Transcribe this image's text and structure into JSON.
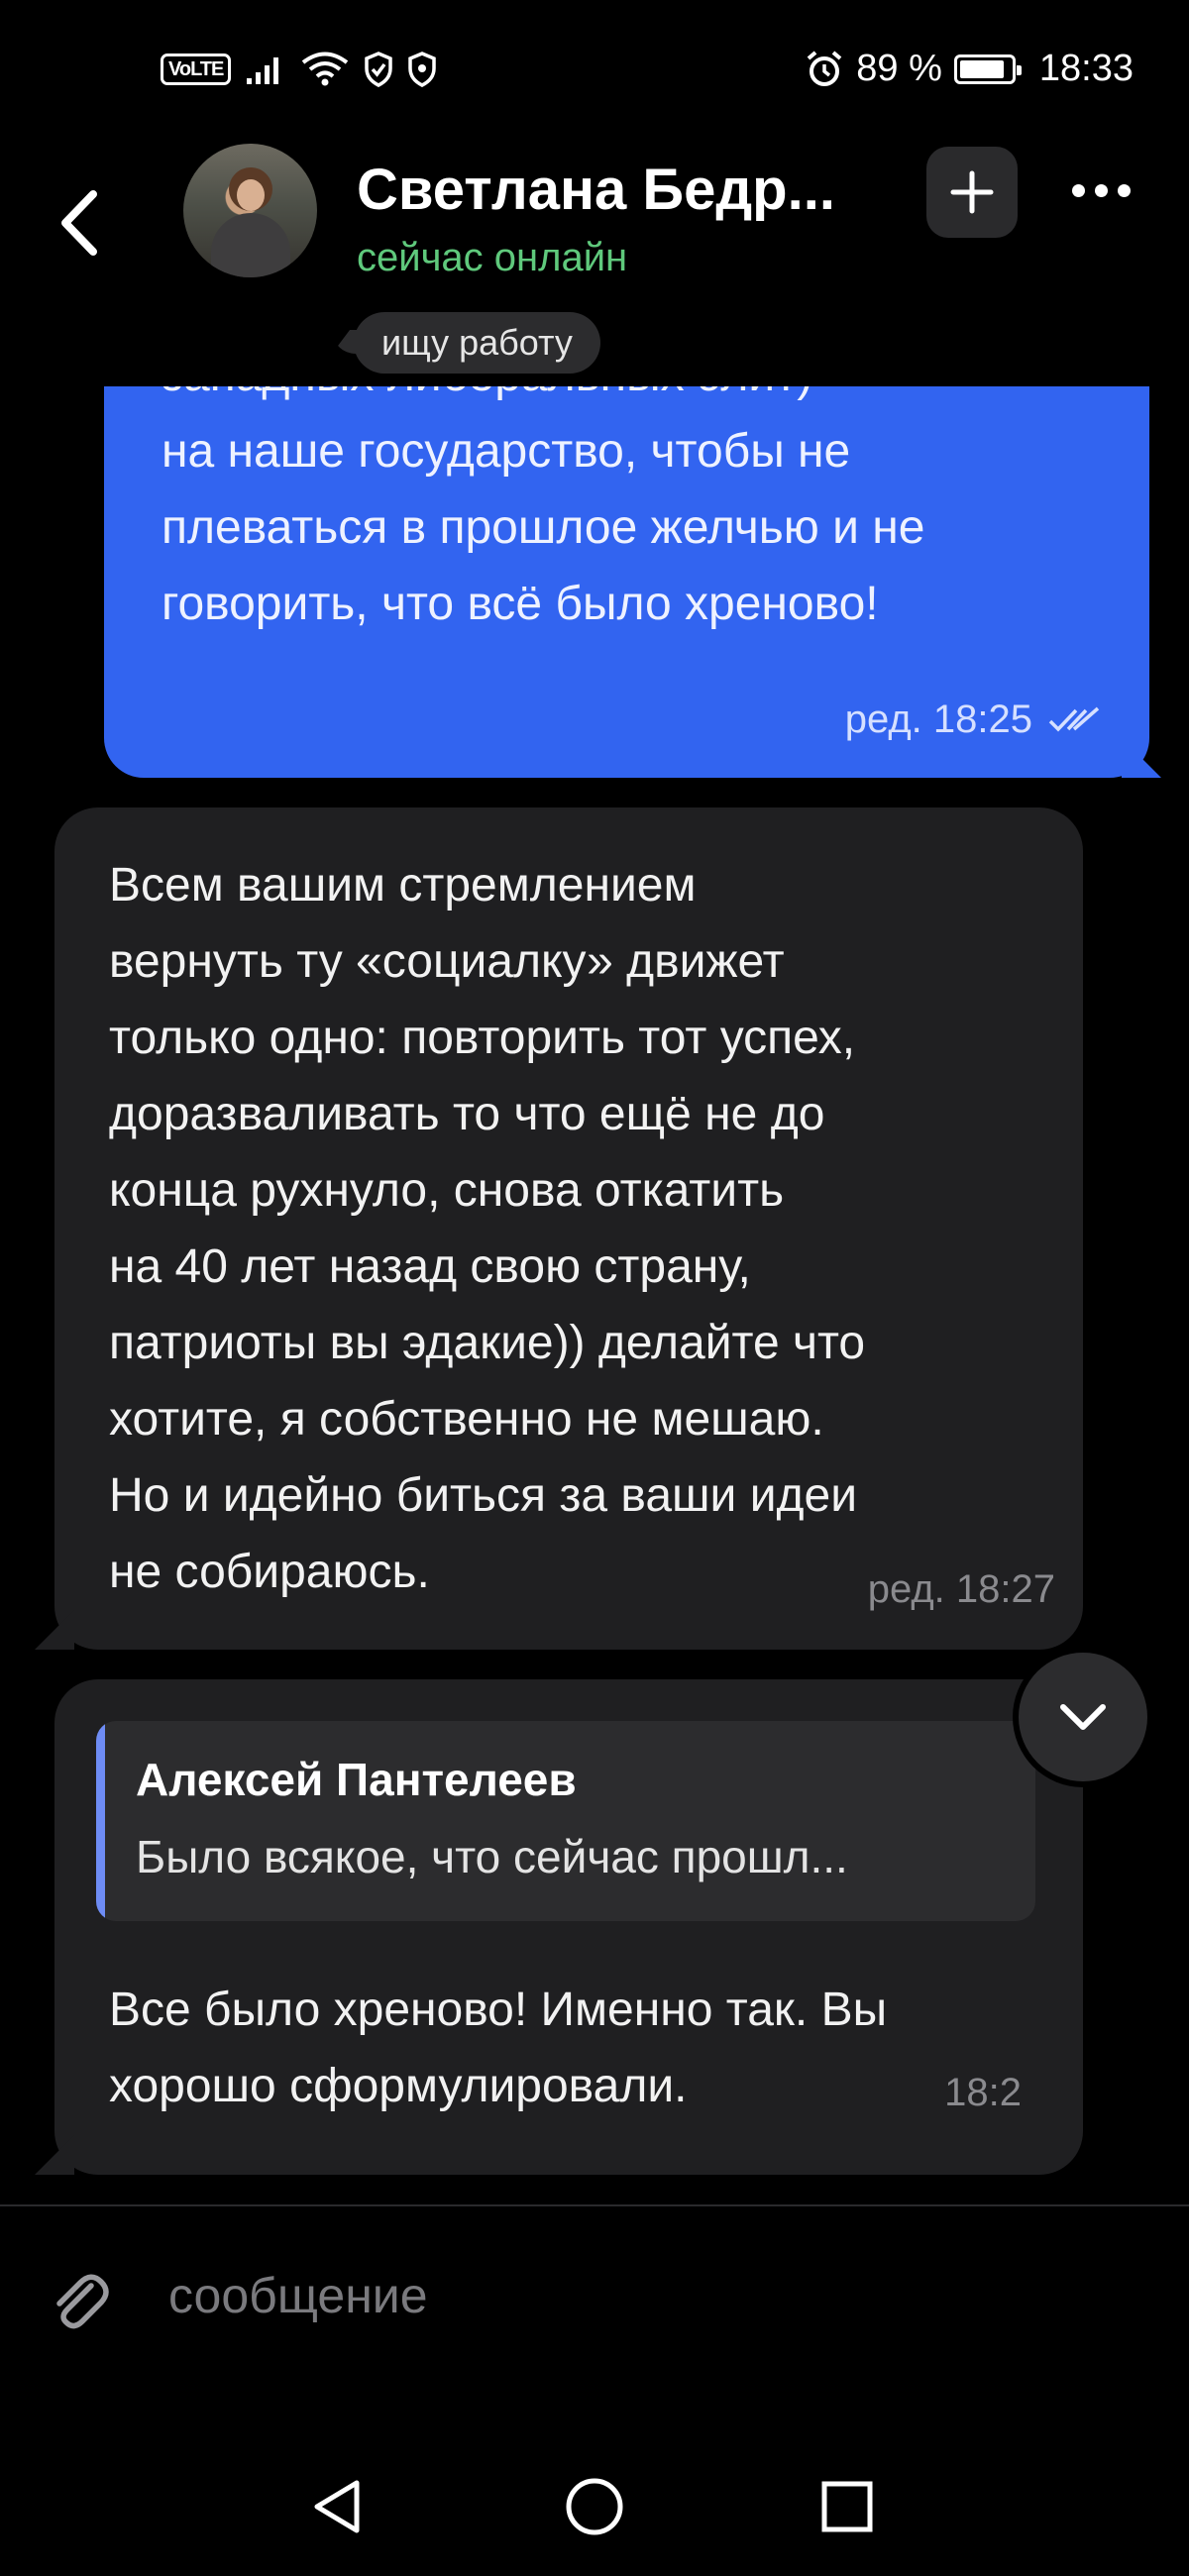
{
  "status_bar": {
    "volte": "VoLTE",
    "battery_percent": "89 %",
    "battery_level": 0.89,
    "time": "18:33"
  },
  "header": {
    "contact_name": "Светлана Бедр...",
    "contact_status": "сейчас онлайн",
    "status_badge": "ищу работу"
  },
  "messages": [
    {
      "direction": "outgoing",
      "text_lines": [
        "западных либеральных элит)",
        "на наше государство, чтобы не",
        "плеваться в прошлое желчью и не",
        "говорить, что всё было хреново!"
      ],
      "meta": "ред. 18:25",
      "read": true
    },
    {
      "direction": "incoming",
      "text_lines": [
        "Всем вашим стремлением",
        "вернуть ту «социалку» движет",
        "только одно: повторить тот успех,",
        "доразваливать то что ещё не до",
        "конца рухнуло, снова откатить",
        "на 40 лет назад свою страну,",
        "патриоты вы эдакие)) делайте что",
        "хотите, я собственно не мешаю.",
        "Но и идейно биться за ваши идеи",
        "не собираюсь."
      ],
      "meta": "ред. 18:27"
    },
    {
      "direction": "incoming",
      "reply_author": "Алексей Пантелеев",
      "reply_text": "Было всякое, что сейчас прошл...",
      "text_lines": [
        "Все было хреново! Именно так. Вы",
        "хорошо сформулировали."
      ],
      "meta": "18:2"
    }
  ],
  "composer": {
    "placeholder": "сообщение"
  },
  "icons": {
    "back": "chevron-left-icon",
    "add": "plus-icon",
    "more": "more-horizontal-icon",
    "scroll_down": "chevron-down-icon",
    "attach": "paperclip-icon",
    "nav_back": "triangle-back-icon",
    "nav_home": "circle-home-icon",
    "nav_recents": "square-recents-icon"
  },
  "colors": {
    "outgoing_bubble": "#3264f0",
    "incoming_bubble": "#1f1f21",
    "online_status": "#5fc97c",
    "quote_accent": "#6e8cf5"
  }
}
